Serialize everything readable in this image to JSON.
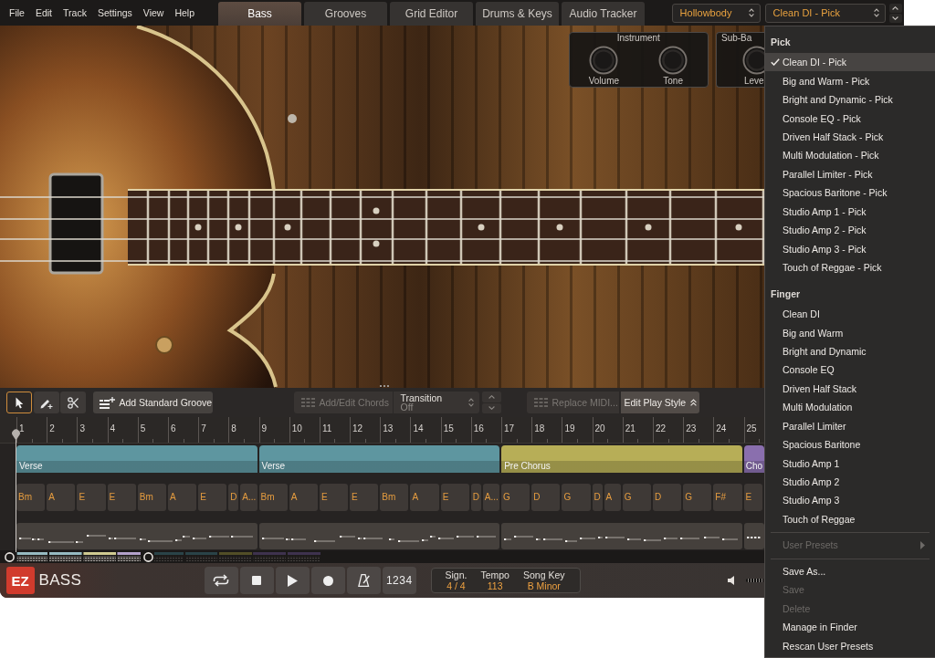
{
  "menu_bar": [
    "File",
    "Edit",
    "Track",
    "Settings",
    "View",
    "Help"
  ],
  "tabs": [
    {
      "label": "Bass",
      "selected": true
    },
    {
      "label": "Grooves",
      "selected": false
    },
    {
      "label": "Grid Editor",
      "selected": false
    },
    {
      "label": "Drums & Keys",
      "selected": false
    },
    {
      "label": "Audio Tracker",
      "selected": false
    }
  ],
  "instrument_select": {
    "value": "Hollowbody"
  },
  "preset_select": {
    "value": "Clean DI - Pick"
  },
  "mixer_panels": [
    {
      "title": "Instrument",
      "knobs": [
        {
          "label": "Volume"
        },
        {
          "label": "Tone"
        }
      ]
    },
    {
      "title": "Sub-Ba",
      "knobs": [
        {
          "label": "Leve"
        }
      ]
    }
  ],
  "toolbar": {
    "tools": [
      {
        "kind": "select",
        "selected": true
      },
      {
        "kind": "draw",
        "selected": false
      },
      {
        "kind": "split",
        "selected": false
      }
    ],
    "add_groove": {
      "label": "Add Standard Groove"
    },
    "chords": {
      "label": "Add/Edit Chords",
      "disabled": true
    },
    "transition": {
      "label": "Transition",
      "value": "Off"
    },
    "replace_midi": {
      "label": "Replace MIDI...",
      "disabled": true
    },
    "play_style": {
      "label": "Edit Play Style"
    }
  },
  "timeline": {
    "bar_numbers": [
      "1",
      "2",
      "3",
      "4",
      "5",
      "6",
      "7",
      "8",
      "9",
      "10",
      "11",
      "12",
      "13",
      "14",
      "15",
      "16",
      "17",
      "18",
      "19",
      "20",
      "21",
      "22",
      "23",
      "24",
      "25"
    ],
    "sections": [
      {
        "label": "Verse",
        "color": "#5e96a0"
      },
      {
        "label": "Verse",
        "color": "#5e96a0"
      },
      {
        "label": "Pre Chorus",
        "color": "#b7ae57"
      },
      {
        "label": "Cho",
        "color": "#8a6fae"
      }
    ],
    "chord_bars": [
      [
        "Bm"
      ],
      [
        "A"
      ],
      [
        "E"
      ],
      [
        "E"
      ],
      [
        "Bm"
      ],
      [
        "A"
      ],
      [
        "E"
      ],
      [
        "D",
        "A..."
      ],
      [
        "Bm"
      ],
      [
        "A"
      ],
      [
        "E"
      ],
      [
        "E"
      ],
      [
        "Bm"
      ],
      [
        "A"
      ],
      [
        "E"
      ],
      [
        "D",
        "A..."
      ],
      [
        "G"
      ],
      [
        "D"
      ],
      [
        "G"
      ],
      [
        "D",
        "A"
      ],
      [
        "G"
      ],
      [
        "D"
      ],
      [
        "G"
      ],
      [
        "F#"
      ],
      [
        "E"
      ]
    ]
  },
  "transport": {
    "logo": {
      "badge": "EZ",
      "name": "BASS"
    },
    "buttons": [
      {
        "kind": "loop"
      },
      {
        "kind": "stop"
      },
      {
        "kind": "play"
      },
      {
        "kind": "record"
      },
      {
        "kind": "metronome"
      },
      {
        "kind": "count_in",
        "label": "1234"
      }
    ],
    "song_info": [
      {
        "label": "Sign.",
        "value": "4 / 4"
      },
      {
        "label": "Tempo",
        "value": "113"
      },
      {
        "label": "Song Key",
        "value": "B Minor"
      }
    ],
    "master_volume": {
      "level": 1
    }
  },
  "preset_menu": {
    "groups": [
      {
        "heading": "Pick",
        "items": [
          {
            "label": "Clean DI - Pick",
            "selected": true
          },
          {
            "label": "Big and Warm - Pick",
            "selected": false
          },
          {
            "label": "Bright and Dynamic - Pick",
            "selected": false
          },
          {
            "label": "Console EQ - Pick",
            "selected": false
          },
          {
            "label": "Driven Half Stack - Pick",
            "selected": false
          },
          {
            "label": "Multi Modulation - Pick",
            "selected": false
          },
          {
            "label": "Parallel Limiter - Pick",
            "selected": false
          },
          {
            "label": "Spacious Baritone - Pick",
            "selected": false
          },
          {
            "label": "Studio Amp 1 - Pick",
            "selected": false
          },
          {
            "label": "Studio Amp 2 - Pick",
            "selected": false
          },
          {
            "label": "Studio Amp 3 - Pick",
            "selected": false
          },
          {
            "label": "Touch of Reggae - Pick",
            "selected": false
          }
        ]
      },
      {
        "heading": "Finger",
        "items": [
          {
            "label": "Clean DI",
            "selected": false
          },
          {
            "label": "Big and Warm",
            "selected": false
          },
          {
            "label": "Bright and Dynamic",
            "selected": false
          },
          {
            "label": "Console EQ",
            "selected": false
          },
          {
            "label": "Driven Half Stack",
            "selected": false
          },
          {
            "label": "Multi Modulation",
            "selected": false
          },
          {
            "label": "Parallel Limiter",
            "selected": false
          },
          {
            "label": "Spacious Baritone",
            "selected": false
          },
          {
            "label": "Studio Amp 1",
            "selected": false
          },
          {
            "label": "Studio Amp 2",
            "selected": false
          },
          {
            "label": "Studio Amp 3",
            "selected": false
          },
          {
            "label": "Touch of Reggae",
            "selected": false
          }
        ]
      }
    ],
    "submenu": {
      "label": "User Presets",
      "disabled": true
    },
    "actions": [
      {
        "label": "Save As...",
        "disabled": false
      },
      {
        "label": "Save",
        "disabled": true
      },
      {
        "label": "Delete",
        "disabled": true
      },
      {
        "label": "Manage in Finder",
        "disabled": false
      },
      {
        "label": "Rescan User Presets",
        "disabled": false
      }
    ]
  }
}
